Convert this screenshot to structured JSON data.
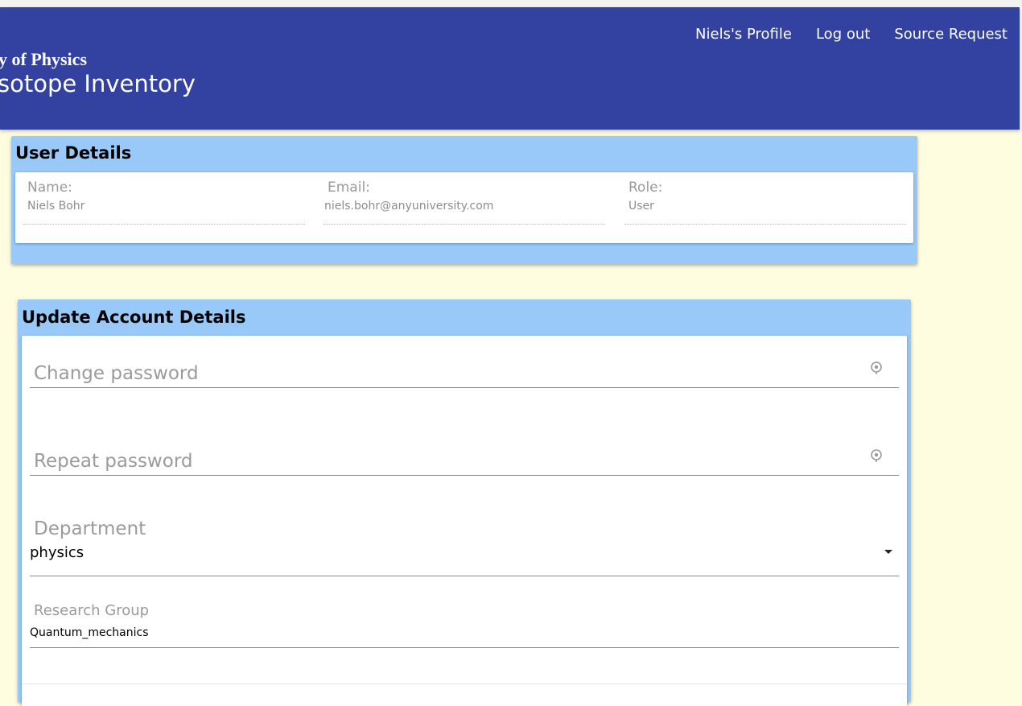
{
  "header": {
    "department_title": "y of Physics",
    "app_title": "sotope Inventory",
    "nav": [
      "Niels's Profile",
      "Log out",
      "Source Request"
    ]
  },
  "user_details": {
    "title": "User Details",
    "fields": [
      {
        "label": "Name:",
        "value": "Niels Bohr"
      },
      {
        "label": "Email:",
        "value": "niels.bohr@anyuniversity.com"
      },
      {
        "label": "Role:",
        "value": "User"
      }
    ]
  },
  "account_form": {
    "title": "Update Account Details",
    "change_password_placeholder": "Change password",
    "repeat_password_placeholder": "Repeat password",
    "department_label": "Department",
    "department_value": "physics",
    "research_group_label": "Research Group",
    "research_group_value": "Quantum_mechanics"
  },
  "icons": {
    "password_toggle": "eye-icon",
    "dropdown": "caret-down-icon"
  },
  "colors": {
    "header": "#3341a1",
    "panel": "#98c9f8",
    "background": "#fffde0"
  }
}
